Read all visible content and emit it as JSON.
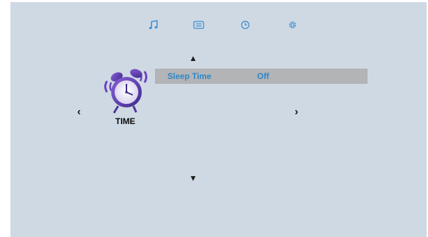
{
  "menu": {
    "tabs": [
      {
        "icon": "music-note-icon",
        "active": false
      },
      {
        "icon": "list-icon",
        "active": false
      },
      {
        "icon": "clock-icon",
        "active": true
      },
      {
        "icon": "gear-icon",
        "active": false
      }
    ],
    "section_label": "TIME",
    "section_icon": "alarm-clock-icon",
    "items": [
      {
        "label": "Sleep Time",
        "value": "Off"
      }
    ],
    "colors": {
      "background": "#cfd9e4",
      "accent": "#2d86c8",
      "selected_row": "#b3b4b6"
    }
  }
}
